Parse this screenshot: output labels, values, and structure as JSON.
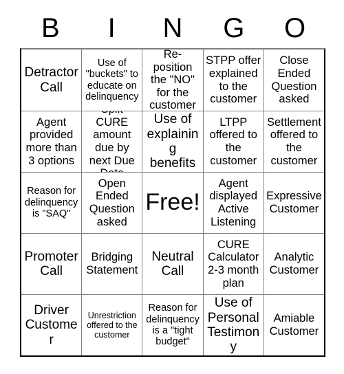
{
  "card": {
    "title_letters": [
      "B",
      "I",
      "N",
      "G",
      "O"
    ],
    "rows": [
      [
        {
          "text": "Detractor Call",
          "size": "lg"
        },
        {
          "text": "Use of \"buckets\" to educate on delinquency",
          "size": "sm"
        },
        {
          "text": "Re-position the \"NO\" for the customer",
          "size": "md"
        },
        {
          "text": "STPP offer explained to the customer",
          "size": "md"
        },
        {
          "text": "Close Ended Question asked",
          "size": "md"
        }
      ],
      [
        {
          "text": "Agent provided more than 3 options",
          "size": "md"
        },
        {
          "text": "Split CURE amount due by next Due Date",
          "size": "md"
        },
        {
          "text": "Use of explaining benefits",
          "size": "lg"
        },
        {
          "text": "LTPP offered to the customer",
          "size": "md"
        },
        {
          "text": "Settlement offered to the customer",
          "size": "md"
        }
      ],
      [
        {
          "text": "Reason for delinquency is \"SAQ\"",
          "size": "sm"
        },
        {
          "text": "Open Ended Question asked",
          "size": "md"
        },
        {
          "text": "Free!",
          "size": "xl"
        },
        {
          "text": "Agent displayed Active Listening",
          "size": "md"
        },
        {
          "text": "Expressive Customer",
          "size": "md"
        }
      ],
      [
        {
          "text": "Promoter Call",
          "size": "lg"
        },
        {
          "text": "Bridging Statement",
          "size": "md"
        },
        {
          "text": "Neutral Call",
          "size": "lg"
        },
        {
          "text": "CURE Calculator 2-3 month plan",
          "size": "md"
        },
        {
          "text": "Analytic Customer",
          "size": "md"
        }
      ],
      [
        {
          "text": "Driver Customer",
          "size": "lg"
        },
        {
          "text": "Unrestriction offered to the customer",
          "size": "xs"
        },
        {
          "text": "Reason for delinquency is a \"tight budget\"",
          "size": "sm"
        },
        {
          "text": "Use of Personal Testimony",
          "size": "lg"
        },
        {
          "text": "Amiable Customer",
          "size": "md"
        }
      ]
    ]
  }
}
